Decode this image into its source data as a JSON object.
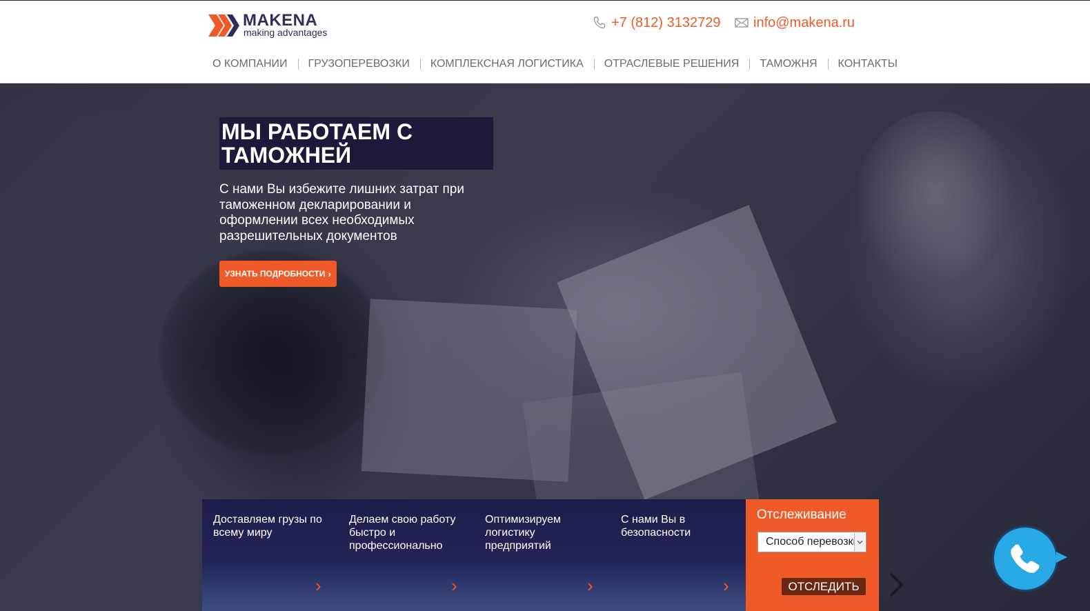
{
  "header": {
    "logo": {
      "name": "MAKENA",
      "tagline": "making advantages",
      "colors": {
        "brand_dark": "#2b2f5a",
        "brand_accent": "#f05a28"
      }
    },
    "phone": {
      "icon": "phone-icon",
      "text": "+7 (812) 3132729"
    },
    "email": {
      "icon": "mail-icon",
      "text": "info@makena.ru"
    },
    "nav": [
      {
        "label": "О КОМПАНИИ"
      },
      {
        "label": "ГРУЗОПЕРЕВОЗКИ"
      },
      {
        "label": "КОМПЛЕКСНАЯ ЛОГИСТИКА"
      },
      {
        "label": "ОТРАСЛЕВЫЕ РЕШЕНИЯ"
      },
      {
        "label": "ТАМОЖНЯ"
      },
      {
        "label": "КОНТАКТЫ"
      }
    ]
  },
  "hero": {
    "title": "МЫ РАБОТАЕМ С ТАМОЖНЕЙ",
    "subtitle": "С нами Вы избежите лишних затрат при таможенном декларировании и оформлении всех необходимых разрешительных документов",
    "button_label": "УЗНАТЬ ПОДРОБНОСТИ",
    "button_icon": "chevron-right-icon"
  },
  "features": [
    {
      "text": "Доставляем грузы по всему миру"
    },
    {
      "text": "Делаем свою работу быстро и профессионально"
    },
    {
      "text": "Оптимизируем логистику предприятий"
    },
    {
      "text": "С нами Вы в безопасности"
    }
  ],
  "tracking": {
    "title": "Отслеживание",
    "select_value": "Способ перевозки",
    "button_label": "ОТСЛЕДИТЬ"
  },
  "call_button": {
    "icon": "phone-handset-icon"
  },
  "colors": {
    "accent": "#f05a28",
    "nav_text": "#6b6b6b",
    "feature_bg": "#1c1d4a",
    "call_blue": "#29a8e6"
  }
}
